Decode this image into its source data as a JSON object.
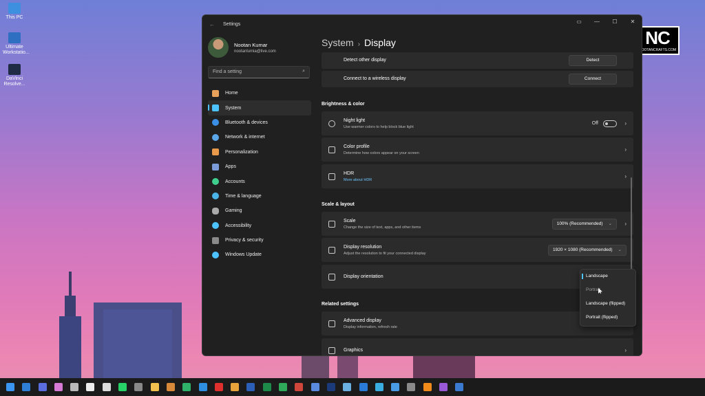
{
  "desktop": {
    "icons": [
      {
        "label": "This PC"
      },
      {
        "label": "Ultimate Workstatio..."
      },
      {
        "label": "DaVinci Resolve..."
      }
    ]
  },
  "watermark": {
    "big": "NC",
    "small": "NOOTANCRAFTS.COM"
  },
  "window": {
    "title": "Settings",
    "back": "←",
    "controls": {
      "compact": "▭",
      "minimize": "—",
      "maximize": "☐",
      "close": "✕"
    }
  },
  "profile": {
    "name": "Nootan Kumar",
    "email": "nootanlumia@live.com"
  },
  "search": {
    "placeholder": "Find a setting"
  },
  "nav": [
    {
      "label": "Home",
      "icon": "home-icon",
      "color": "#e8a15a"
    },
    {
      "label": "System",
      "icon": "monitor-icon",
      "color": "#4cc2ff"
    },
    {
      "label": "Bluetooth & devices",
      "icon": "bluetooth-icon",
      "color": "#3a8ee6"
    },
    {
      "label": "Network & internet",
      "icon": "wifi-icon",
      "color": "#5aa6e8"
    },
    {
      "label": "Personalization",
      "icon": "brush-icon",
      "color": "#e89a4a"
    },
    {
      "label": "Apps",
      "icon": "apps-icon",
      "color": "#7a9ad8"
    },
    {
      "label": "Accounts",
      "icon": "person-icon",
      "color": "#3ecf8e"
    },
    {
      "label": "Time & language",
      "icon": "globe-clock-icon",
      "color": "#4ab3e8"
    },
    {
      "label": "Gaming",
      "icon": "gamepad-icon",
      "color": "#aaaaaa"
    },
    {
      "label": "Accessibility",
      "icon": "accessibility-icon",
      "color": "#4cc2ff"
    },
    {
      "label": "Privacy & security",
      "icon": "shield-icon",
      "color": "#8a8a8a"
    },
    {
      "label": "Windows Update",
      "icon": "sync-icon",
      "color": "#4cc2ff"
    }
  ],
  "breadcrumb": {
    "parent": "System",
    "separator": "›",
    "current": "Display"
  },
  "rows": {
    "detect": {
      "title": "Detect other display",
      "button": "Detect"
    },
    "connect": {
      "title": "Connect to a wireless display",
      "button": "Connect"
    },
    "brightness_header": "Brightness & color",
    "night_light": {
      "title": "Night light",
      "subtitle": "Use warmer colors to help block blue light",
      "state": "Off"
    },
    "color_profile": {
      "title": "Color profile",
      "subtitle": "Determine how colors appear on your screen"
    },
    "hdr": {
      "title": "HDR",
      "subtitle": "More about HDR"
    },
    "scale_header": "Scale & layout",
    "scale": {
      "title": "Scale",
      "subtitle": "Change the size of text, apps, and other items",
      "value": "100% (Recommended)"
    },
    "resolution": {
      "title": "Display resolution",
      "subtitle": "Adjust the resolution to fit your connected display",
      "value": "1920 × 1080 (Recommended)"
    },
    "orientation": {
      "title": "Display orientation"
    },
    "related_header": "Related settings",
    "advanced": {
      "title": "Advanced display",
      "subtitle": "Display information, refresh rate"
    },
    "graphics": {
      "title": "Graphics"
    }
  },
  "orientation_menu": [
    {
      "label": "Landscape",
      "selected": true
    },
    {
      "label": "Portrait",
      "selected": false
    },
    {
      "label": "Landscape (flipped)",
      "selected": false
    },
    {
      "label": "Portrait (flipped)",
      "selected": false
    }
  ],
  "taskbar": {
    "items": [
      {
        "icon": "start-icon",
        "color": "#3a96f0"
      },
      {
        "icon": "info-icon",
        "color": "#2f7fd6"
      },
      {
        "icon": "chat-icon",
        "color": "#5a6ee0"
      },
      {
        "icon": "copilot-icon",
        "color": "#d77ad6"
      },
      {
        "icon": "tool-icon",
        "color": "#bbbbbb"
      },
      {
        "icon": "store-icon",
        "color": "#eeeeee"
      },
      {
        "icon": "chatgpt-icon",
        "color": "#dddddd"
      },
      {
        "icon": "whatsapp-icon",
        "color": "#27d366"
      },
      {
        "icon": "terminal-icon",
        "color": "#888888"
      },
      {
        "icon": "folder-icon",
        "color": "#f2c14e"
      },
      {
        "icon": "photos-icon",
        "color": "#d88a3a"
      },
      {
        "icon": "edge-dev-icon",
        "color": "#2fb36a"
      },
      {
        "icon": "edge-icon",
        "color": "#2e8fe0"
      },
      {
        "icon": "opera-icon",
        "color": "#e0302e"
      },
      {
        "icon": "chrome-icon",
        "color": "#e8a33a"
      },
      {
        "icon": "word-icon",
        "color": "#2b5fb8"
      },
      {
        "icon": "excel-icon",
        "color": "#1e8a4a"
      },
      {
        "icon": "sheets-icon",
        "color": "#2faa5a"
      },
      {
        "icon": "powerpoint-icon",
        "color": "#d0463a"
      },
      {
        "icon": "files-icon",
        "color": "#5a8ae0"
      },
      {
        "icon": "photoshop-icon",
        "color": "#1a3a7a"
      },
      {
        "icon": "notepad-icon",
        "color": "#6ab0e0"
      },
      {
        "icon": "notes-icon",
        "color": "#2a7ad8"
      },
      {
        "icon": "calc-icon",
        "color": "#3aaee0"
      },
      {
        "icon": "phone-icon",
        "color": "#4a9be6"
      },
      {
        "icon": "settings-icon",
        "color": "#8a8a8a"
      },
      {
        "icon": "vlc-icon",
        "color": "#f08a1a"
      },
      {
        "icon": "app-purple-icon",
        "color": "#9a5ad8"
      },
      {
        "icon": "app-blue-icon",
        "color": "#3a7ad0"
      }
    ]
  }
}
